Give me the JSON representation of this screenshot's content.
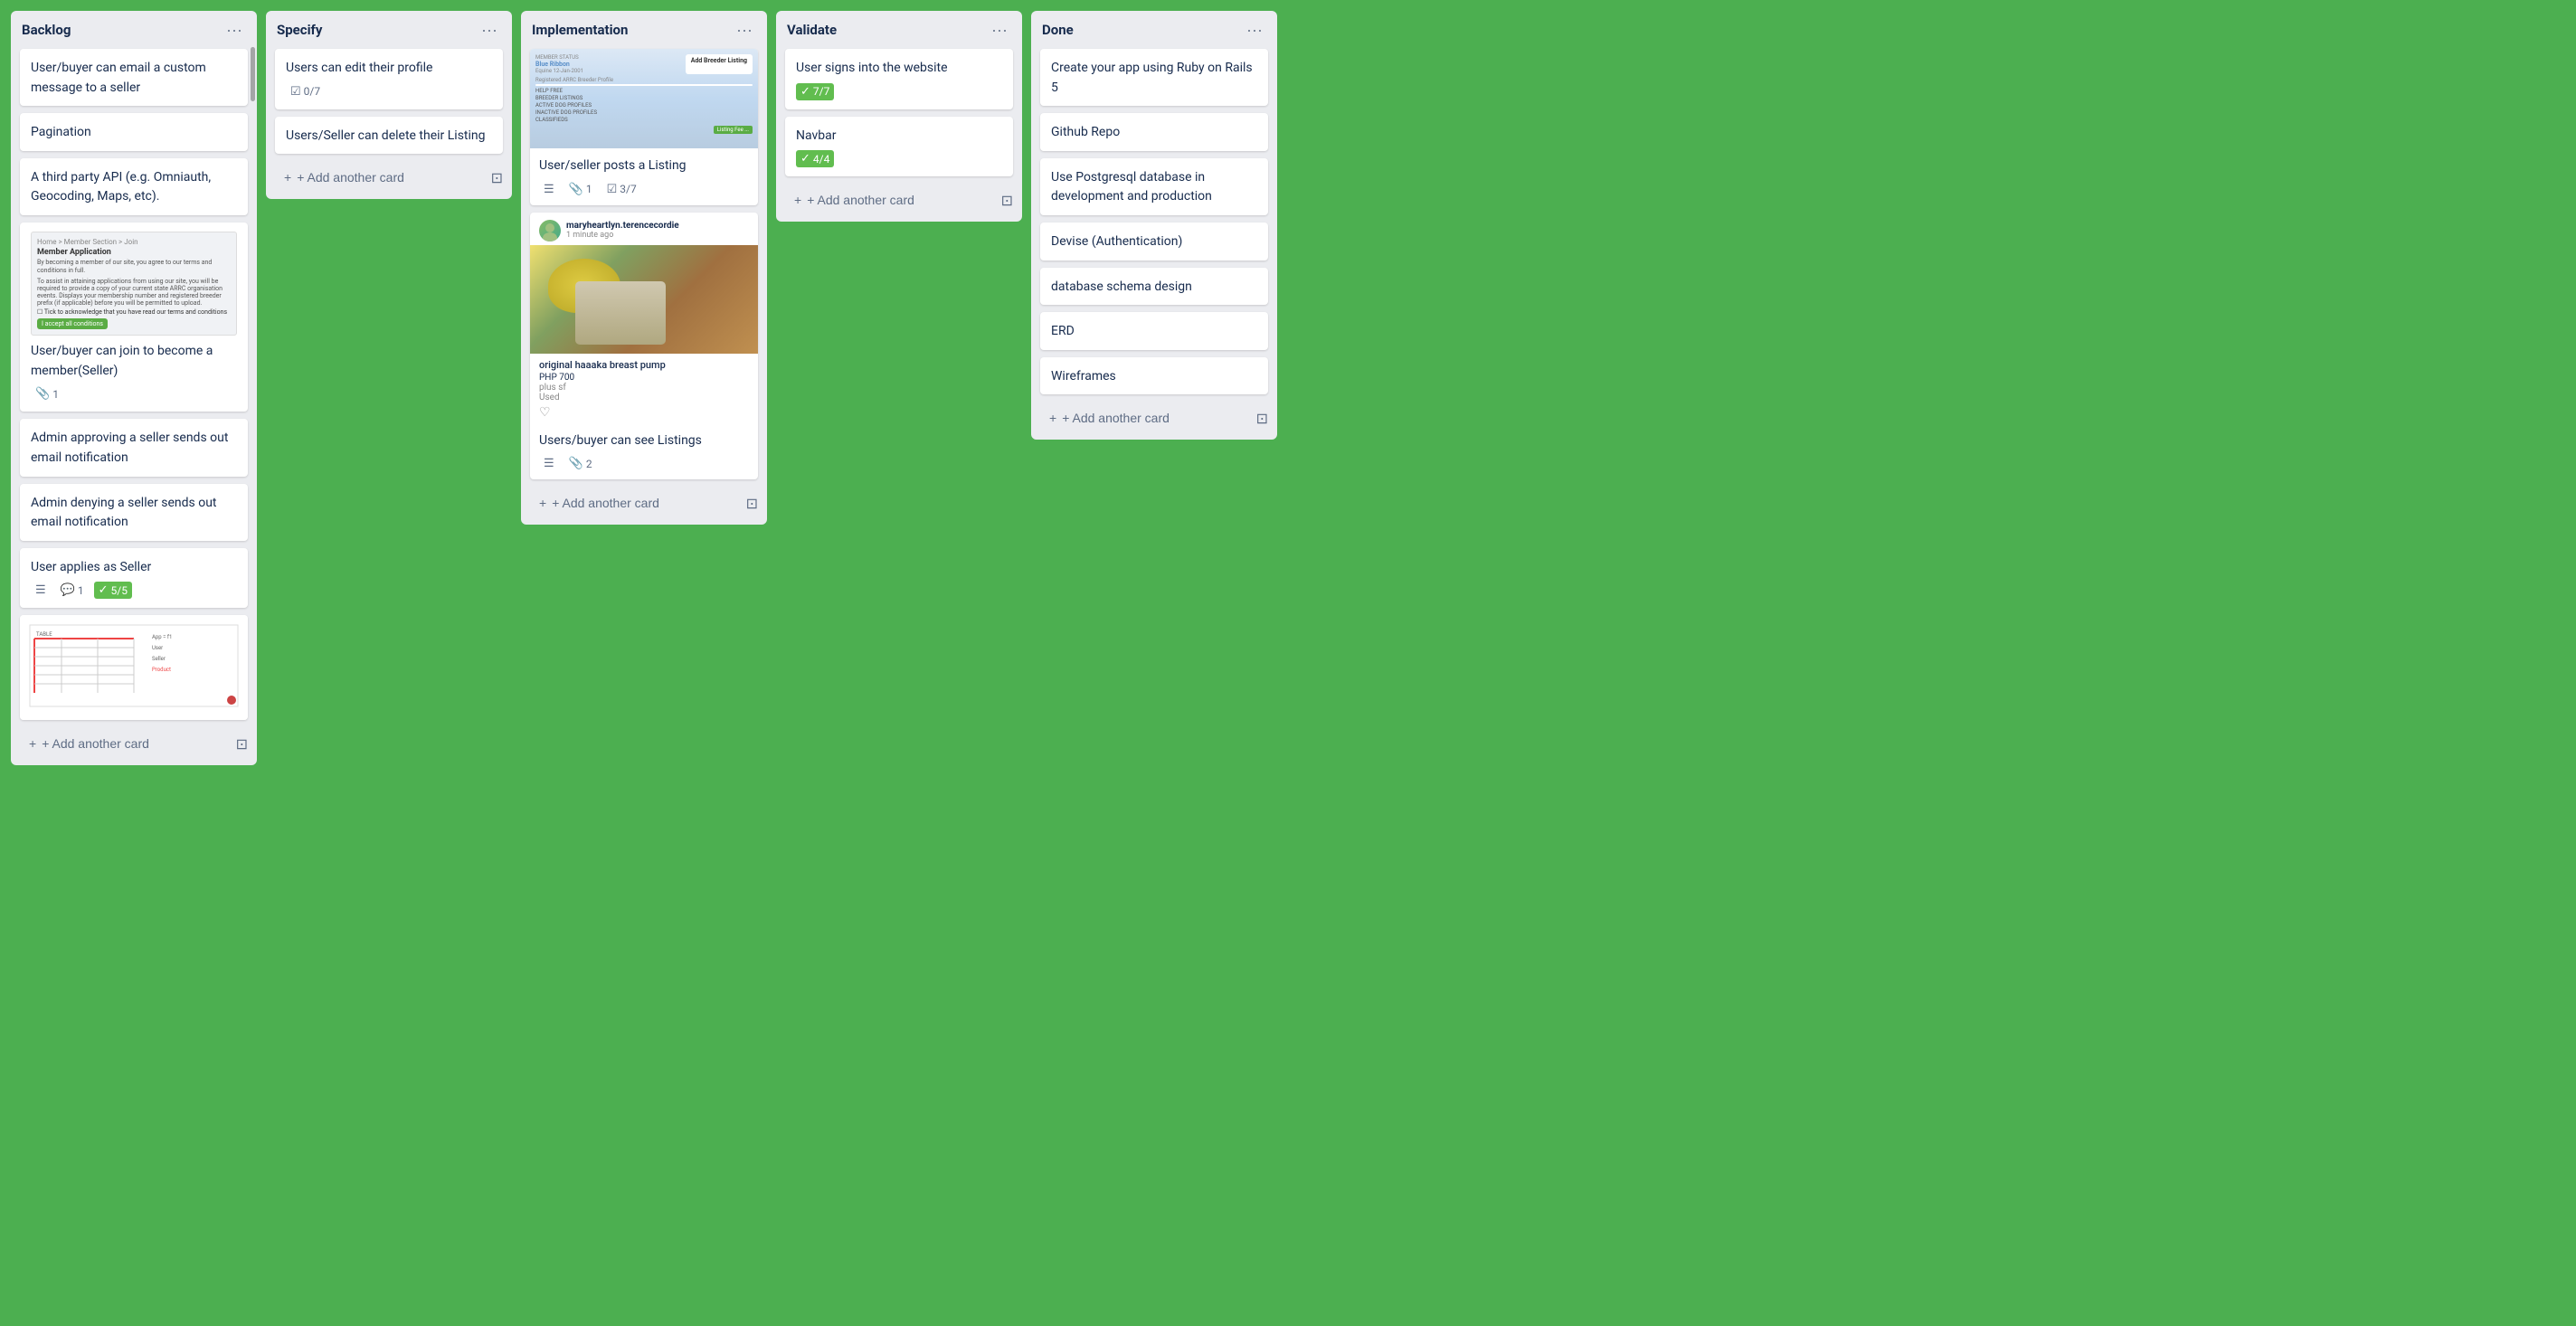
{
  "board": {
    "background": "#4caf50"
  },
  "columns": [
    {
      "id": "backlog",
      "title": "Backlog",
      "cards": [
        {
          "id": "b1",
          "title": "User/buyer can email a custom message to a seller",
          "type": "text",
          "meta": []
        },
        {
          "id": "b2",
          "title": "Pagination",
          "type": "text",
          "meta": []
        },
        {
          "id": "b3",
          "title": "A third party API (e.g. Omniauth, Geocoding, Maps, etc).",
          "type": "text",
          "meta": []
        },
        {
          "id": "b4",
          "title": "User/buyer can join to become a member(Seller)",
          "type": "text-with-image",
          "meta": [
            {
              "type": "attachment",
              "value": "1"
            }
          ]
        },
        {
          "id": "b5",
          "title": "Admin approving a seller sends out email notification",
          "type": "text",
          "meta": []
        },
        {
          "id": "b6",
          "title": "Admin denying a seller sends out email notification",
          "type": "text",
          "meta": []
        },
        {
          "id": "b7",
          "title": "User applies as Seller",
          "type": "text",
          "meta": [
            {
              "type": "lines",
              "value": ""
            },
            {
              "type": "comment",
              "value": "1"
            },
            {
              "type": "checklist",
              "value": "5/5",
              "done": true
            }
          ]
        },
        {
          "id": "b8",
          "title": "",
          "type": "sketch-image",
          "meta": []
        }
      ],
      "add_label": "+ Add another card"
    },
    {
      "id": "specify",
      "title": "Specify",
      "cards": [
        {
          "id": "s1",
          "title": "Users can edit their profile",
          "type": "text",
          "meta": [
            {
              "type": "checklist",
              "value": "0/7",
              "done": false
            }
          ]
        },
        {
          "id": "s2",
          "title": "Users/Seller can delete their Listing",
          "type": "text",
          "meta": []
        }
      ],
      "add_label": "+ Add another card"
    },
    {
      "id": "implementation",
      "title": "Implementation",
      "cards": [
        {
          "id": "i1",
          "title": "User/seller posts a Listing",
          "type": "breeder-image",
          "meta": [
            {
              "type": "lines",
              "value": ""
            },
            {
              "type": "attachment",
              "value": "1"
            },
            {
              "type": "checklist",
              "value": "3/7",
              "done": false
            }
          ]
        },
        {
          "id": "i2",
          "title": "Users/buyer can see Listings",
          "type": "listing-image",
          "meta": [
            {
              "type": "lines",
              "value": ""
            },
            {
              "type": "attachment",
              "value": "2"
            }
          ]
        }
      ],
      "add_label": "+ Add another card"
    },
    {
      "id": "validate",
      "title": "Validate",
      "cards": [
        {
          "id": "v1",
          "title": "User signs into the website",
          "type": "text",
          "meta": [
            {
              "type": "checklist",
              "value": "7/7",
              "done": true
            }
          ]
        },
        {
          "id": "v2",
          "title": "Navbar",
          "type": "text",
          "meta": [
            {
              "type": "checklist",
              "value": "4/4",
              "done": true
            }
          ]
        }
      ],
      "add_label": "+ Add another card"
    },
    {
      "id": "done",
      "title": "Done",
      "cards": [
        {
          "id": "d1",
          "title": "Create your app using Ruby on Rails 5",
          "type": "text",
          "meta": []
        },
        {
          "id": "d2",
          "title": "Github Repo",
          "type": "text",
          "meta": []
        },
        {
          "id": "d3",
          "title": "Use Postgresql database in development and production",
          "type": "text",
          "meta": []
        },
        {
          "id": "d4",
          "title": "Devise (Authentication)",
          "type": "text",
          "meta": []
        },
        {
          "id": "d5",
          "title": "database schema design",
          "type": "text",
          "meta": []
        },
        {
          "id": "d6",
          "title": "ERD",
          "type": "text",
          "meta": []
        },
        {
          "id": "d7",
          "title": "Wireframes",
          "type": "text",
          "meta": []
        }
      ],
      "add_label": "+ Add another card"
    }
  ],
  "labels": {
    "add_card": "+ Add another card",
    "menu_dots": "···"
  }
}
